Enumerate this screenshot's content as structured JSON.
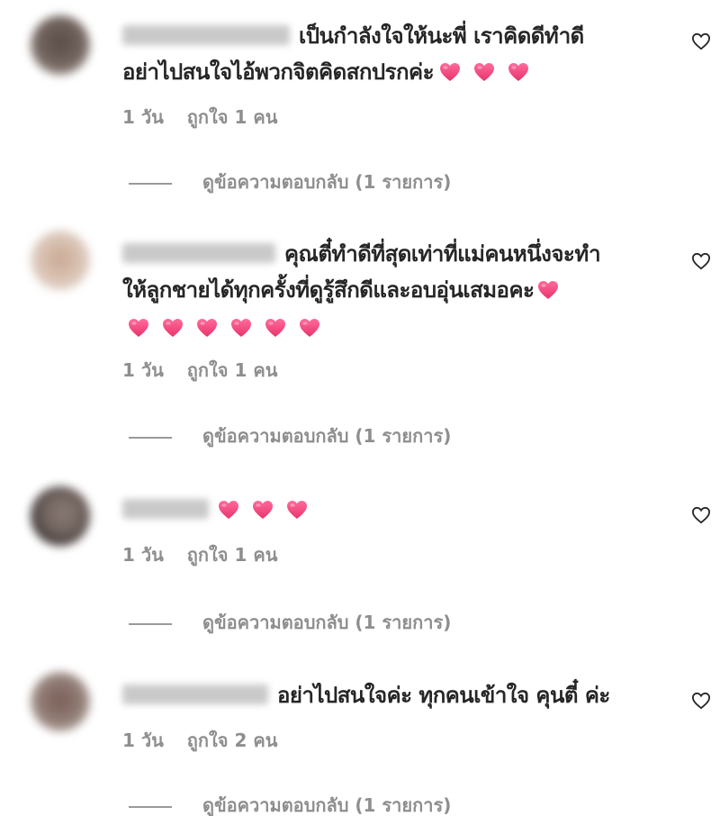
{
  "comments": [
    {
      "lines": [
        "เป็นกำลังใจให้นะพี่ เราคิดดีทำดี",
        "อย่าไปสนใจไอ้พวกจิตคิดสกปรกค่ะ"
      ],
      "time": "1 วัน",
      "likes": "ถูกใจ 1 คน",
      "replies": "ดูข้อความตอบกลับ (1 รายการ)"
    },
    {
      "lines": [
        "คุณตี๋ทำดีที่สุดเท่าที่แม่คนหนึ่งจะทำ",
        "ให้ลูกชายได้ทุกครั้งที่ดูรู้สึกดีและอบอุ่นเสมอคะ"
      ],
      "time": "1 วัน",
      "likes": "ถูกใจ 1 คน",
      "replies": "ดูข้อความตอบกลับ (1 รายการ)"
    },
    {
      "lines": [],
      "time": "1 วัน",
      "likes": "ถูกใจ 1 คน",
      "replies": "ดูข้อความตอบกลับ (1 รายการ)"
    },
    {
      "lines": [
        "อย่าไปสนใจค่ะ ทุกคนเข้าใจ คุนตี๋ ค่ะ"
      ],
      "time": "1 วัน",
      "likes": "ถูกใจ 2 คน",
      "replies": "ดูข้อความตอบกลับ (1 รายการ)"
    }
  ],
  "icons": {
    "heart_emoji": "heart-emoji",
    "like": "heart-outline-icon"
  },
  "colors": {
    "heart": "#f0437a",
    "meta": "#8e8e8e",
    "text": "#262626"
  }
}
